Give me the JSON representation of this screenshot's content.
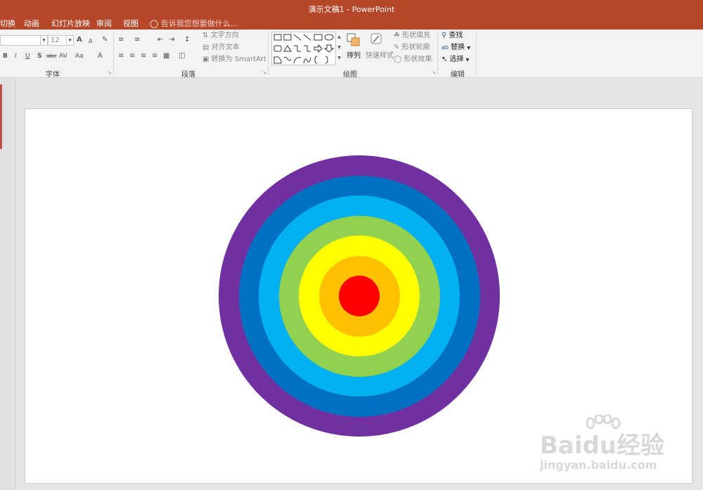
{
  "window": {
    "title": "演示文稿1 - PowerPoint",
    "title_bar_color": "#b7472a"
  },
  "tabs": [
    {
      "label": "切换"
    },
    {
      "label": "动画"
    },
    {
      "label": "幻灯片放映"
    },
    {
      "label": "审阅"
    },
    {
      "label": "视图"
    }
  ],
  "tell_me": {
    "placeholder": "告诉我您想要做什么..."
  },
  "ribbon": {
    "font_group": {
      "label": "字体",
      "font_name_value": "",
      "font_size_value": "12",
      "bold": "B",
      "italic": "I",
      "underline": "U",
      "shadow": "S",
      "strikethrough": "abc",
      "char_spacing": "AV",
      "change_case": "Aa",
      "grow_font": "A",
      "shrink_font": "A",
      "font_color": "A"
    },
    "paragraph_group": {
      "label": "段落",
      "text_direction": "文字方向",
      "align_text": "对齐文本",
      "convert_smartart": "转换为 SmartArt"
    },
    "drawing_group": {
      "label": "绘图",
      "arrange": "排列",
      "quick_styles": "快速样式",
      "shape_fill": "形状填充",
      "shape_outline": "形状轮廓",
      "shape_effects": "形状效果"
    },
    "editing_group": {
      "label": "编辑",
      "find": "查找",
      "replace": "替换",
      "select": "选择"
    }
  },
  "slide": {
    "target_rings": [
      {
        "color": "#7030a0"
      },
      {
        "color": "#0070c0"
      },
      {
        "color": "#00b0f0"
      },
      {
        "color": "#92d050"
      },
      {
        "color": "#ffff00"
      },
      {
        "color": "#ffc000"
      },
      {
        "color": "#ff0000"
      }
    ]
  },
  "watermark": {
    "brand": "Baidu经验",
    "url": "jingyan.baidu.com"
  }
}
